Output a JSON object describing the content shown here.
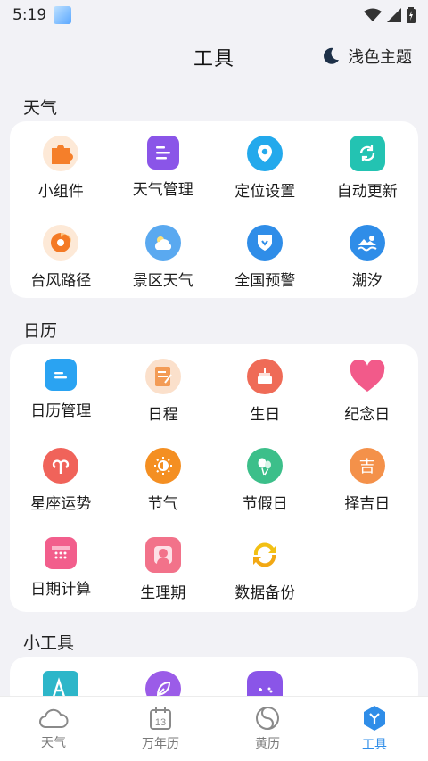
{
  "status_bar": {
    "time": "5:19"
  },
  "header": {
    "title": "工具",
    "theme_label": "浅色主题"
  },
  "sections": [
    {
      "title": "天气",
      "items": [
        {
          "label": "小组件",
          "icon": "puzzle-icon",
          "color": "#f57f2a"
        },
        {
          "label": "天气管理",
          "icon": "list-icon",
          "color": "#8a55e8"
        },
        {
          "label": "定位设置",
          "icon": "location-icon",
          "color": "#23a9ec"
        },
        {
          "label": "自动更新",
          "icon": "refresh-icon",
          "color": "#23c3b2"
        },
        {
          "label": "台风路径",
          "icon": "typhoon-icon",
          "color": "#f47a25"
        },
        {
          "label": "景区天气",
          "icon": "scenic-weather-icon",
          "color": "#5aa9f0"
        },
        {
          "label": "全国预警",
          "icon": "warning-shield-icon",
          "color": "#2f8de8"
        },
        {
          "label": "潮汐",
          "icon": "tide-icon",
          "color": "#2f8de8"
        }
      ]
    },
    {
      "title": "日历",
      "items": [
        {
          "label": "日历管理",
          "icon": "calendar-manage-icon",
          "color": "#2aa3f2"
        },
        {
          "label": "日程",
          "icon": "schedule-icon",
          "color": "#f39b55"
        },
        {
          "label": "生日",
          "icon": "cake-icon",
          "color": "#ef6b57"
        },
        {
          "label": "纪念日",
          "icon": "heart-icon",
          "color": "#f25a8a"
        },
        {
          "label": "星座运势",
          "icon": "aries-icon",
          "color": "#f0635a"
        },
        {
          "label": "节气",
          "icon": "sun-icon",
          "color": "#f48f22"
        },
        {
          "label": "节假日",
          "icon": "balloon-icon",
          "color": "#3cbf8a"
        },
        {
          "label": "择吉日",
          "icon": "lucky-icon",
          "color": "#f4914a",
          "glyph": "吉"
        },
        {
          "label": "日期计算",
          "icon": "date-calc-icon",
          "color": "#f25e8c"
        },
        {
          "label": "生理期",
          "icon": "period-icon",
          "color": "#f2728a"
        },
        {
          "label": "数据备份",
          "icon": "backup-icon",
          "color": "#f2c014"
        }
      ]
    },
    {
      "title": "小工具",
      "items": [
        {
          "label": "",
          "icon": "font-icon",
          "color": "#2db6c9"
        },
        {
          "label": "",
          "icon": "leaf-icon",
          "color": "#9b5ce8"
        },
        {
          "label": "",
          "icon": "game-icon",
          "color": "#8a55e8"
        }
      ]
    }
  ],
  "bottom_nav": [
    {
      "label": "天气",
      "icon": "cloud-icon",
      "active": false
    },
    {
      "label": "万年历",
      "icon": "calendar-13-icon",
      "active": false,
      "day": "13"
    },
    {
      "label": "黄历",
      "icon": "yinyang-icon",
      "active": false
    },
    {
      "label": "工具",
      "icon": "tools-icon",
      "active": true
    }
  ],
  "colors": {
    "accent": "#2f8de8",
    "background": "#f2f2f6"
  }
}
